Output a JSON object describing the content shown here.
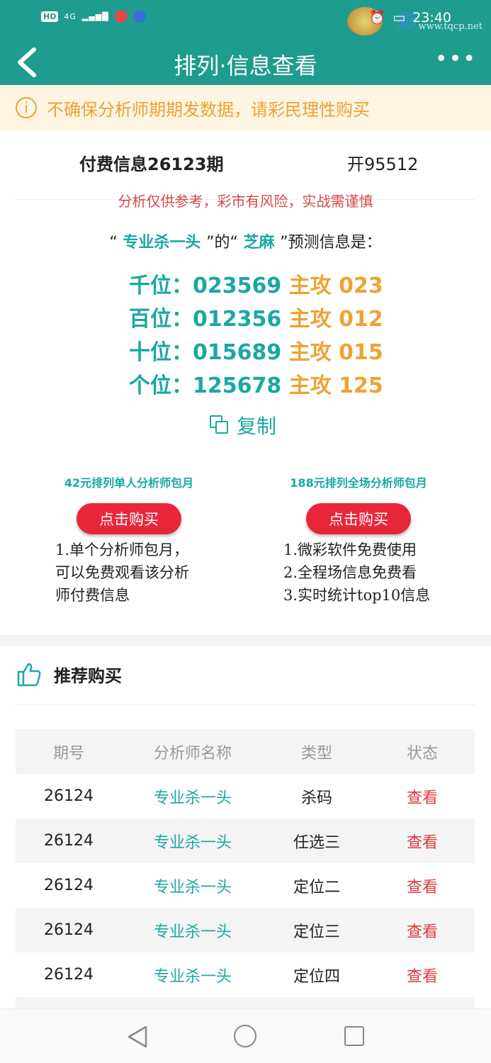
{
  "status_bar": {
    "hd": "HD",
    "network": "4G",
    "time": "23:40",
    "watermark_site": "www.tqcp.net"
  },
  "nav": {
    "title": "排列·信息查看",
    "more": "•••"
  },
  "notice": {
    "text": "不确保分析师期期发数据，请彩民理性购买"
  },
  "info": {
    "heading": "付费信息26123期",
    "open": "开95512",
    "warning": "分析仅供参考，彩市有风险，实战需谨慎",
    "predict_prefix": "“",
    "analyst": " 专业杀一头 ",
    "predict_mid": "”的“",
    "nickname": " 芝麻 ",
    "predict_suffix": "”预测信息是：",
    "rows": [
      {
        "label": "千位：",
        "nums": "023569",
        "main": " 主攻 023"
      },
      {
        "label": "百位：",
        "nums": "012356",
        "main": " 主攻 012"
      },
      {
        "label": "十位：",
        "nums": "015689",
        "main": " 主攻 015"
      },
      {
        "label": "个位：",
        "nums": "125678",
        "main": " 主攻 125"
      }
    ],
    "copy_label": "复制"
  },
  "packages": [
    {
      "title": "42元排列单人分析师包月",
      "button": "点击购买",
      "desc": [
        "1.单个分析师包月，",
        "可以免费观看该分析",
        "师付费信息"
      ]
    },
    {
      "title": "188元排列全场分析师包月",
      "button": "点击购买",
      "desc": [
        "1.微彩软件免费使用",
        "2.全程场信息免费看",
        "3.实时统计top10信息"
      ]
    }
  ],
  "recommend": {
    "title": "推荐购买",
    "columns": [
      "期号",
      "分析师名称",
      "类型",
      "状态"
    ],
    "rows": [
      {
        "period": "26124",
        "name": "专业杀一头",
        "type": "杀码",
        "status": "查看"
      },
      {
        "period": "26124",
        "name": "专业杀一头",
        "type": "任选三",
        "status": "查看"
      },
      {
        "period": "26124",
        "name": "专业杀一头",
        "type": "定位二",
        "status": "查看"
      },
      {
        "period": "26124",
        "name": "专业杀一头",
        "type": "定位三",
        "status": "查看"
      },
      {
        "period": "26124",
        "name": "专业杀一头",
        "type": "定位四",
        "status": "查看"
      }
    ]
  },
  "colors": {
    "primary": "#1d9c8f",
    "accent_teal": "#1aa8a1",
    "accent_orange": "#f0a233",
    "red": "#e8263a"
  }
}
